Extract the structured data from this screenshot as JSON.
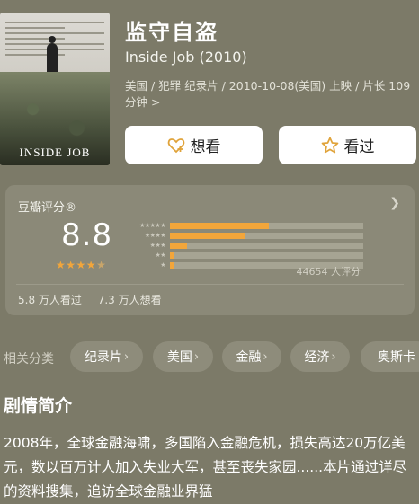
{
  "movie": {
    "title": "监守自盗",
    "original_title": "Inside Job (2010)",
    "meta": "美国 / 犯罪 纪录片 / 2010-10-08(美国) 上映 / 片长 109 分钟 >"
  },
  "poster": {
    "title": "INSIDE JOB"
  },
  "actions": {
    "want_label": "想看",
    "seen_label": "看过"
  },
  "rating": {
    "label": "豆瓣评分®",
    "score": "8.8",
    "stars": 4.5,
    "distribution": [
      {
        "stars": "★★★★★",
        "fraction": 0.51
      },
      {
        "stars": "★★★★",
        "fraction": 0.39
      },
      {
        "stars": "★★★",
        "fraction": 0.09
      },
      {
        "stars": "★★",
        "fraction": 0.02
      },
      {
        "stars": "★",
        "fraction": 0.02
      }
    ],
    "count_text": "44654 人评分",
    "seen_text": "5.8 万人看过",
    "want_text": "7.3 万人想看"
  },
  "tags": {
    "label": "相关分类",
    "items": [
      "纪录片",
      "美国",
      "金融",
      "经济",
      "奥斯卡"
    ]
  },
  "synopsis": {
    "title": "剧情简介",
    "text": "2008年，全球金融海啸，多国陷入金融危机，损失高达20万亿美元，数以百万计人加入失业大军，甚至丧失家园......本片通过详尽的资料搜集，追访全球金融业界猛"
  },
  "colors": {
    "background": "#7c7a68",
    "card": "#8b8978",
    "accent": "#f2a63b"
  }
}
